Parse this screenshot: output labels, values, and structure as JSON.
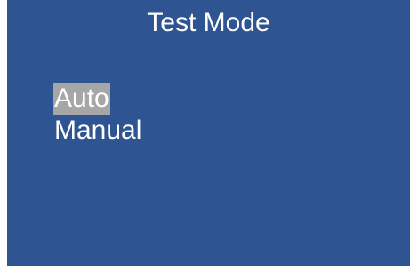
{
  "screen": {
    "title": "Test Mode",
    "menu": {
      "items": [
        {
          "label": "Auto",
          "selected": true
        },
        {
          "label": "Manual",
          "selected": false
        }
      ]
    }
  },
  "colors": {
    "background": "#2e5491",
    "text": "#ffffff",
    "selection_highlight": "#a6a6a6"
  }
}
